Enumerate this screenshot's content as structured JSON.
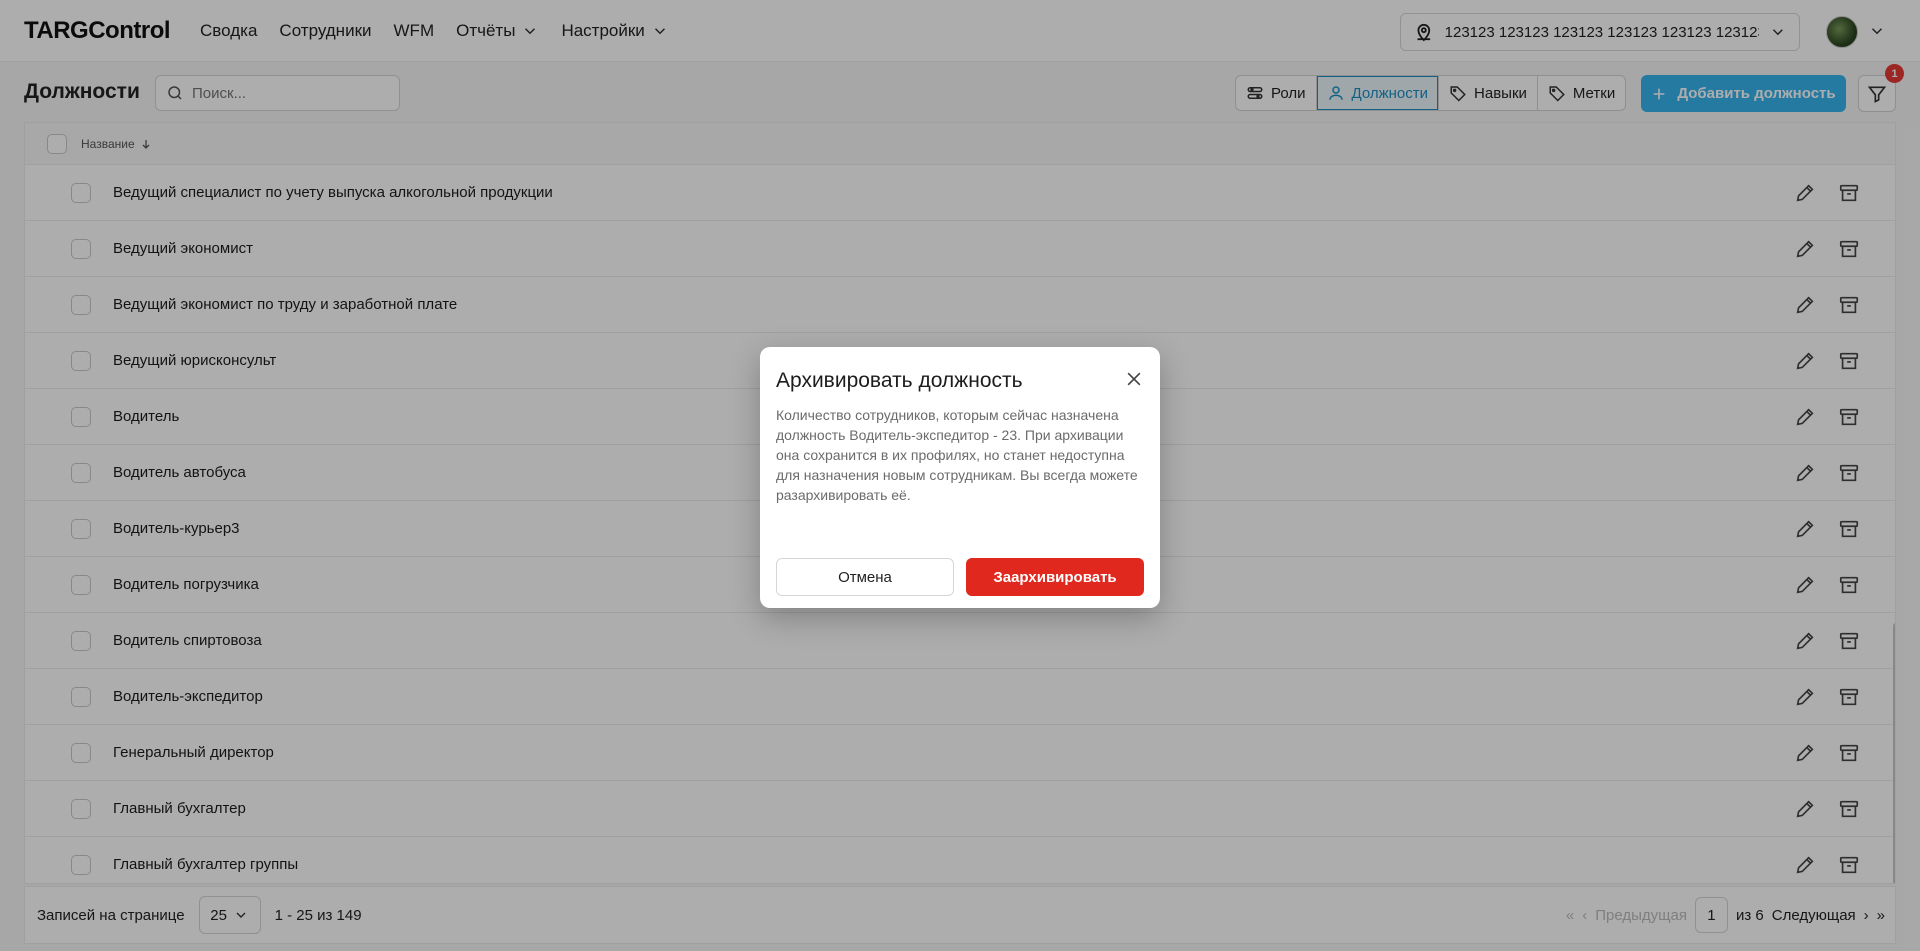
{
  "app": {
    "logo": "TARGControl"
  },
  "nav": {
    "items": [
      {
        "label": "Сводка"
      },
      {
        "label": "Сотрудники"
      },
      {
        "label": "WFM"
      },
      {
        "label": "Отчёты"
      },
      {
        "label": "Настройки"
      }
    ],
    "location": "123123 123123 123123 123123 123123 123123 123123"
  },
  "toolbar": {
    "title": "Должности",
    "search_placeholder": "Поиск...",
    "tabs": [
      {
        "label": "Роли",
        "icon": "roles-icon"
      },
      {
        "label": "Должности",
        "icon": "user-icon"
      },
      {
        "label": "Навыки",
        "icon": "tag-icon"
      },
      {
        "label": "Метки",
        "icon": "tag-icon"
      }
    ],
    "active_tab": "Должности",
    "add_label": "Добавить должность",
    "filter_badge": "1"
  },
  "table": {
    "header": {
      "name": "Название"
    },
    "rows": [
      "Ведущий специалист по учету выпуска алкогольной продукции",
      "Ведущий экономист",
      "Ведущий экономист по труду и заработной плате",
      "Ведущий юрисконсульт",
      "Водитель",
      "Водитель автобуса",
      "Водитель-курьер3",
      "Водитель погрузчика",
      "Водитель спиртовоза",
      "Водитель-экспедитор",
      "Генеральный директор",
      "Главный бухгалтер",
      "Главный бухгалтер группы"
    ]
  },
  "footer": {
    "per_page_label": "Записей на странице",
    "per_page": "25",
    "range": "1 - 25 из 149",
    "prev": "Предыдущая",
    "page": "1",
    "of": "из 6",
    "next": "Следующая"
  },
  "modal": {
    "title": "Архивировать должность",
    "text": "Количество сотрудников, которым сейчас назначена должность Водитель-экспедитор - 23. При архивации она сохранится в их профилях, но станет недоступна для назначения новым сотрудникам. Вы всегда можете разархивировать её.",
    "cancel": "Отмена",
    "confirm": "Заархивировать"
  },
  "colors": {
    "accent": "#37b4ef",
    "danger": "#e0281f"
  }
}
